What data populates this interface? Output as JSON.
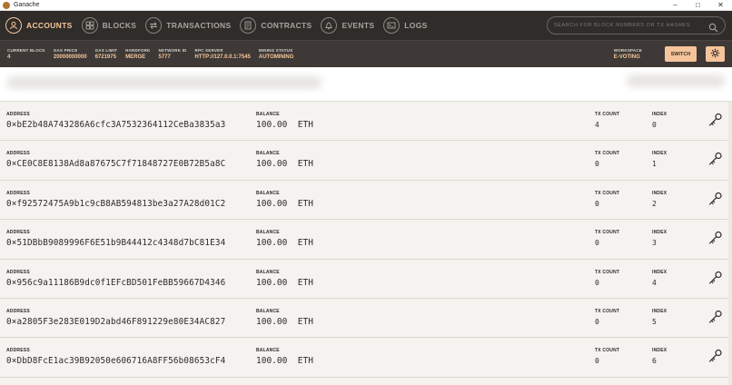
{
  "window": {
    "title": "Ganache"
  },
  "nav": {
    "items": [
      {
        "label": "ACCOUNTS",
        "icon": "person-icon"
      },
      {
        "label": "BLOCKS",
        "icon": "blocks-icon"
      },
      {
        "label": "TRANSACTIONS",
        "icon": "arrows-icon"
      },
      {
        "label": "CONTRACTS",
        "icon": "document-icon"
      },
      {
        "label": "EVENTS",
        "icon": "bell-icon"
      },
      {
        "label": "LOGS",
        "icon": "terminal-icon"
      }
    ],
    "search_placeholder": "SEARCH FOR BLOCK NUMBERS OR TX HASHES"
  },
  "status": {
    "current_block": {
      "label": "CURRENT BLOCK",
      "value": "4"
    },
    "gas_price": {
      "label": "GAS PRICE",
      "value": "20000000000"
    },
    "gas_limit": {
      "label": "GAS LIMIT",
      "value": "6721975"
    },
    "hardfork": {
      "label": "HARDFORK",
      "value": "MERGE"
    },
    "network_id": {
      "label": "NETWORK ID",
      "value": "5777"
    },
    "rpc_server": {
      "label": "RPC SERVER",
      "value": "HTTP://127.0.0.1:7545"
    },
    "mining_status": {
      "label": "MINING STATUS",
      "value": "AUTOMINING"
    },
    "workspace": {
      "label": "WORKSPACE",
      "value": "E-VOTING"
    },
    "switch_label": "SWITCH"
  },
  "labels": {
    "address": "ADDRESS",
    "balance": "BALANCE",
    "tx_count": "TX COUNT",
    "index": "INDEX"
  },
  "accounts": [
    {
      "address": "0×bE2b48A743286A6cfc3A7532364112CeBa3835a3",
      "balance": "100.00  ETH",
      "tx_count": "4",
      "index": "0"
    },
    {
      "address": "0×CE0C8E8138Ad8a87675C7f71848727E0B72B5a8C",
      "balance": "100.00  ETH",
      "tx_count": "0",
      "index": "1"
    },
    {
      "address": "0×f92572475A9b1c9cB8AB594813be3a27A28d01C2",
      "balance": "100.00  ETH",
      "tx_count": "0",
      "index": "2"
    },
    {
      "address": "0×51DBbB9089996F6E51b9B44412c4348d7bC81E34",
      "balance": "100.00  ETH",
      "tx_count": "0",
      "index": "3"
    },
    {
      "address": "0×956c9a11186B9dc0f1EFcBD501FeBB59667D4346",
      "balance": "100.00  ETH",
      "tx_count": "0",
      "index": "4"
    },
    {
      "address": "0×a2805F3e283E019D2abd46F891229e80E34AC827",
      "balance": "100.00  ETH",
      "tx_count": "0",
      "index": "5"
    },
    {
      "address": "0×DbD8FcE1ac39B92050e606716A8FF56b08653cF4",
      "balance": "100.00  ETH",
      "tx_count": "0",
      "index": "6"
    }
  ],
  "colors": {
    "accent": "#f5c49b",
    "nav_bg": "#2f2c2a",
    "status_bg": "#3e3936"
  }
}
